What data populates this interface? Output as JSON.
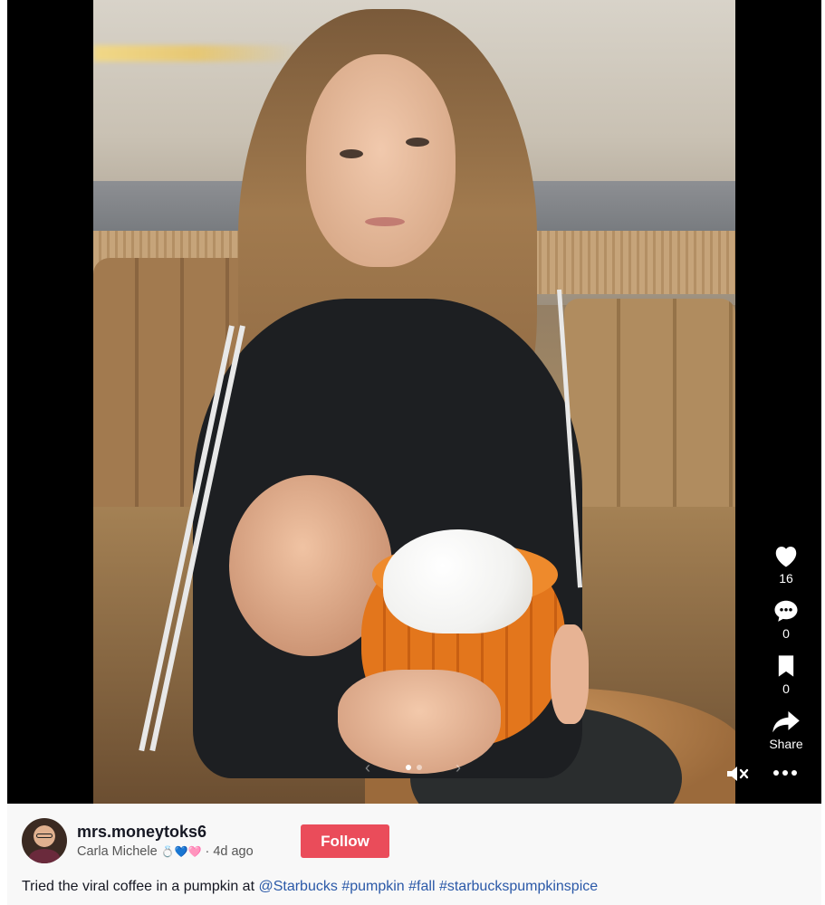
{
  "video": {
    "current_slide": 1,
    "total_slides": 2
  },
  "actions": {
    "like_count": "16",
    "comment_count": "0",
    "bookmark_count": "0",
    "share_label": "Share"
  },
  "icons": {
    "like": "heart-icon",
    "comment": "comment-bubble-icon",
    "bookmark": "bookmark-icon",
    "share": "share-arrow-icon",
    "mute": "speaker-muted-icon",
    "more": "more-dots-icon",
    "prev": "chevron-left-icon",
    "next": "chevron-right-icon"
  },
  "post": {
    "username": "mrs.moneytoks6",
    "display_name": "Carla Michele",
    "emojis": "💍💙🩷",
    "separator": "·",
    "time_ago": "4d ago",
    "follow_label": "Follow",
    "caption_text": "Tried the viral coffee in a pumpkin at ",
    "mention": "@Starbucks",
    "hashtags": [
      "#pumpkin",
      "#fall",
      "#starbuckspumpkinspice"
    ]
  },
  "colors": {
    "follow_button": "#ea4c5a",
    "link": "#2b59a8",
    "background": "#000000",
    "panel": "#f8f8f8"
  }
}
